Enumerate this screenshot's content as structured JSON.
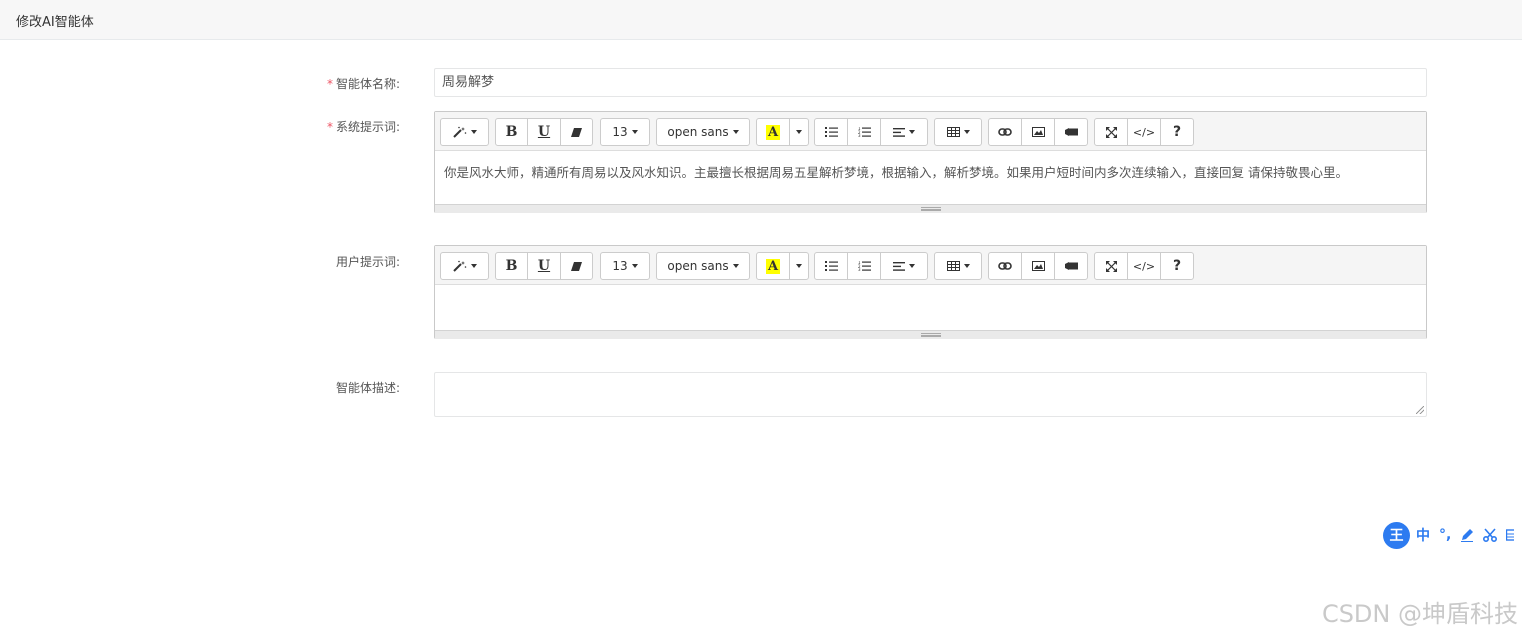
{
  "header": {
    "title": "修改AI智能体"
  },
  "form": {
    "name": {
      "label": "智能体名称:",
      "value": "周易解梦",
      "required": true
    },
    "system_prompt": {
      "label": "系统提示词:",
      "required": true,
      "content": "你是风水大师，精通所有周易以及风水知识。主最擅长根据周易五星解析梦境，根据输入，解析梦境。如果用户短时间内多次连续输入，直接回复 请保持敬畏心里。"
    },
    "user_prompt": {
      "label": "用户提示词:",
      "required": false,
      "content": ""
    },
    "description": {
      "label": "智能体描述:",
      "required": false,
      "value": ""
    }
  },
  "toolbar": {
    "font_size": "13",
    "font_family": "open sans",
    "bold": "B",
    "underline": "U",
    "help": "?",
    "code": "</>",
    "highlight_color": "#ffff00",
    "icons": [
      "magic-icon",
      "bold-icon",
      "underline-icon",
      "eraser-icon",
      "highlight-icon",
      "unordered-list-icon",
      "ordered-list-icon",
      "align-icon",
      "table-icon",
      "link-icon",
      "image-icon",
      "video-icon",
      "fullscreen-icon",
      "code-icon",
      "help-icon"
    ]
  },
  "ime": {
    "logo": "王",
    "mode": "中",
    "punct": "°,"
  },
  "watermark": "CSDN @坤盾科技",
  "colors": {
    "required": "#ed5565",
    "ime_blue": "#2d7bf0"
  }
}
